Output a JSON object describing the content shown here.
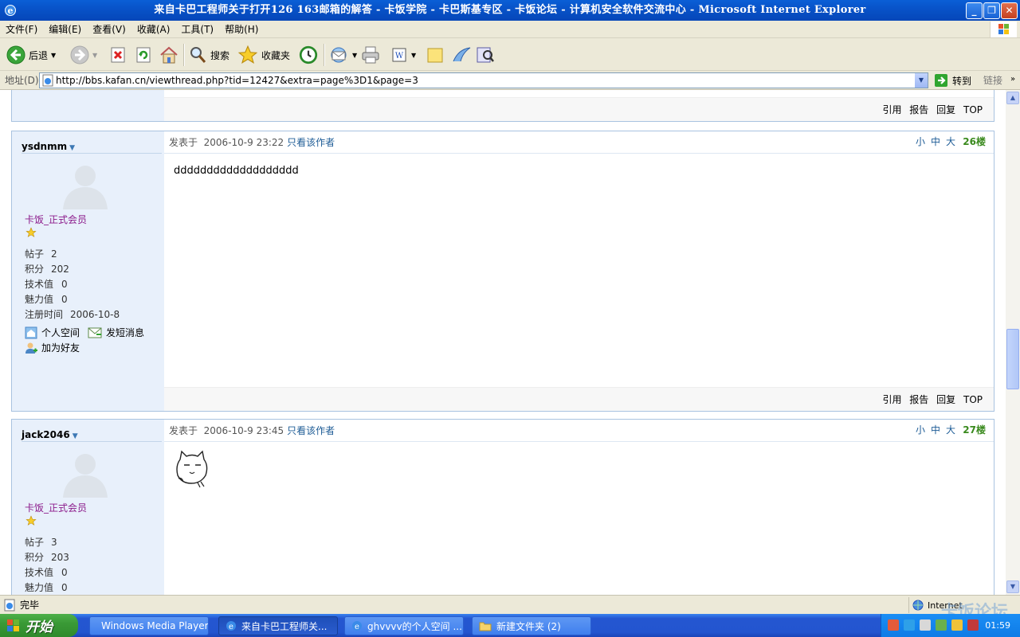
{
  "window": {
    "title": "来自卡巴工程师关于打开126 163邮箱的解答 - 卡饭学院 - 卡巴斯基专区 - 卡饭论坛 - 计算机安全软件交流中心 - Microsoft Internet Explorer"
  },
  "menu": [
    "文件(F)",
    "编辑(E)",
    "查看(V)",
    "收藏(A)",
    "工具(T)",
    "帮助(H)"
  ],
  "toolbar": {
    "back": "后退",
    "search": "搜索",
    "favorites": "收藏夹"
  },
  "address": {
    "label": "地址(D)",
    "url": "http://bbs.kafan.cn/viewthread.php?tid=12427&extra=page%3D1&page=3",
    "go": "转到",
    "links": "链接"
  },
  "post_actions": [
    "引用",
    "报告",
    "回复",
    "TOP"
  ],
  "posts": [
    {
      "username": "ysdnmm",
      "role": "卡饭_正式会员",
      "stats": {
        "posts_label": "帖子",
        "posts": "2",
        "points_label": "积分",
        "points": "202",
        "tech_label": "技术值",
        "tech": "0",
        "charm_label": "魅力值",
        "charm": "0",
        "reg_label": "注册时间",
        "reg": "2006-10-8"
      },
      "space": "个人空间",
      "pm": "发短消息",
      "friend": "加为好友",
      "posted_label": "发表于",
      "date": "2006-10-9 23:22",
      "author_only": "只看该作者",
      "sizes": [
        "小",
        "中",
        "大"
      ],
      "floor": "26楼",
      "content": "ddddddddddddddddddd"
    },
    {
      "username": "jack2046",
      "role": "卡饭_正式会员",
      "stats": {
        "posts_label": "帖子",
        "posts": "3",
        "points_label": "积分",
        "points": "203",
        "tech_label": "技术值",
        "tech": "0",
        "charm_label": "魅力值",
        "charm": "0"
      },
      "posted_label": "发表于",
      "date": "2006-10-9 23:45",
      "author_only": "只看该作者",
      "sizes": [
        "小",
        "中",
        "大"
      ],
      "floor": "27楼"
    }
  ],
  "status": {
    "text": "完毕",
    "zone": "Internet",
    "watermark": "卡饭论坛"
  },
  "taskbar": {
    "start": "开始",
    "tasks": [
      "Windows Media Player",
      "来自卡巴工程师关...",
      "ghvvvv的个人空间 ...",
      "新建文件夹 (2)"
    ],
    "clock": "01:59"
  },
  "colors": {
    "title_blue": "#0853c9",
    "sidebar_bg": "#e8f0fb",
    "role_purple": "#8b1a8b",
    "floor_green": "#3a8a1e",
    "link_blue": "#1e5c96",
    "start_green": "#3a9a36"
  }
}
